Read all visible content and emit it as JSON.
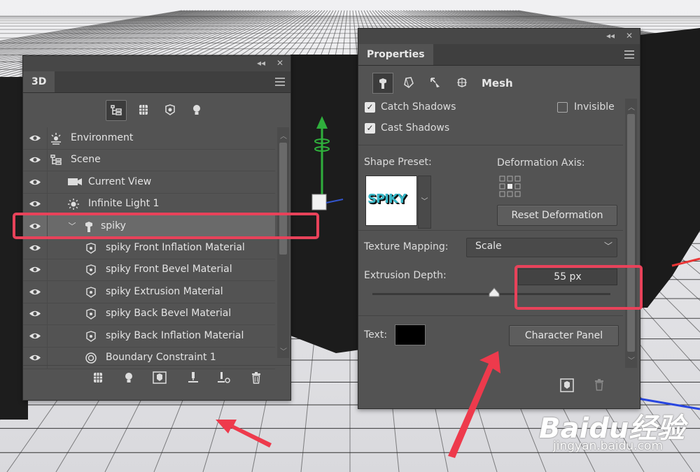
{
  "panel3d": {
    "tab": "3D",
    "toolbar_icons": [
      "scene-filter-icon",
      "mesh-filter-icon",
      "material-filter-icon",
      "light-filter-icon"
    ],
    "layers": [
      {
        "label": "Environment",
        "icon": "environment-icon",
        "indent": 0,
        "selected": false
      },
      {
        "label": "Scene",
        "icon": "scene-icon",
        "indent": 0,
        "selected": false
      },
      {
        "label": "Current View",
        "icon": "camera-icon",
        "indent": 1,
        "selected": false
      },
      {
        "label": "Infinite Light 1",
        "icon": "light-icon",
        "indent": 1,
        "selected": false
      },
      {
        "label": "spiky",
        "icon": "mesh-icon",
        "indent": 1,
        "selected": true
      },
      {
        "label": "spiky Front Inflation Material",
        "icon": "material-icon",
        "indent": 2,
        "selected": false
      },
      {
        "label": "spiky Front Bevel Material",
        "icon": "material-icon",
        "indent": 2,
        "selected": false
      },
      {
        "label": "spiky Extrusion Material",
        "icon": "material-icon",
        "indent": 2,
        "selected": false
      },
      {
        "label": "spiky Back Bevel Material",
        "icon": "material-icon",
        "indent": 2,
        "selected": false
      },
      {
        "label": "spiky Back Inflation Material",
        "icon": "material-icon",
        "indent": 2,
        "selected": false
      },
      {
        "label": "Boundary Constraint 1",
        "icon": "constraint-icon",
        "indent": 2,
        "selected": false
      }
    ]
  },
  "props": {
    "tab": "Properties",
    "mode_label": "Mesh",
    "catch_shadows": "Catch Shadows",
    "cast_shadows": "Cast Shadows",
    "invisible": "Invisible",
    "shape_preset_label": "Shape Preset:",
    "deformation_axis_label": "Deformation Axis:",
    "reset_deformation": "Reset Deformation",
    "texture_mapping_label": "Texture Mapping:",
    "texture_mapping_value": "Scale",
    "extrusion_depth_label": "Extrusion Depth:",
    "extrusion_depth_value": "55 px",
    "text_label": "Text:",
    "character_panel": "Character Panel",
    "preset_thumb_text": "SPIKY"
  },
  "watermark": {
    "brand": "Baidu经验",
    "url": "jingyan.baidu.com"
  },
  "colors": {
    "annotation": "#e8425a",
    "panel_bg": "#535353",
    "text_color_swatch": "#000000"
  }
}
